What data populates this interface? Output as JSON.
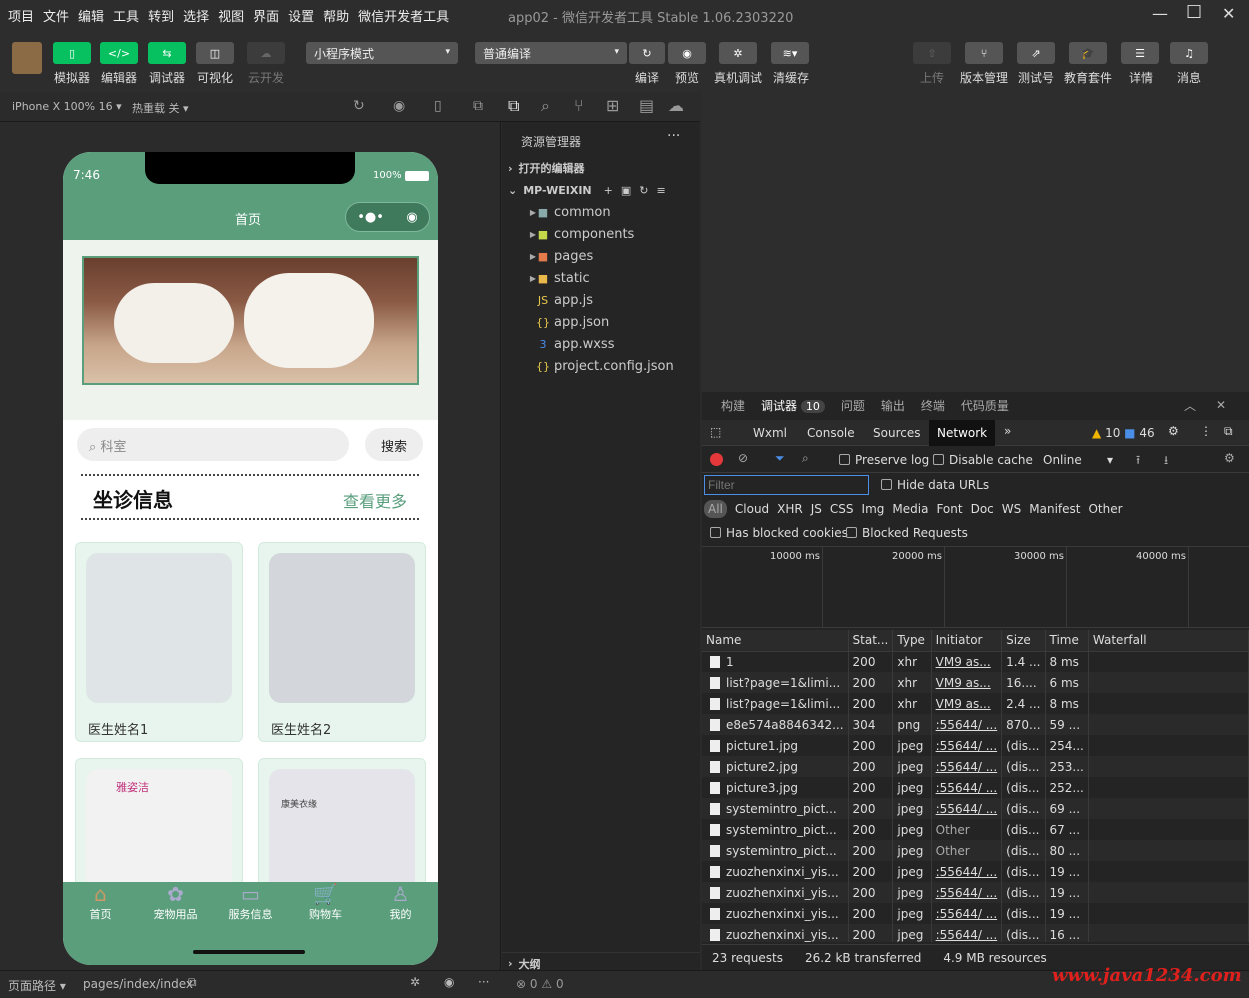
{
  "menu": [
    "项目",
    "文件",
    "编辑",
    "工具",
    "转到",
    "选择",
    "视图",
    "界面",
    "设置",
    "帮助",
    "微信开发者工具"
  ],
  "title": "app02 - 微信开发者工具 Stable 1.06.2303220",
  "toolbar": {
    "simulator": "模拟器",
    "editor": "编辑器",
    "debugger": "调试器",
    "visual": "可视化",
    "cloud": "云开发",
    "mode": "小程序模式",
    "compile_mode": "普通编译",
    "compile": "编译",
    "preview": "预览",
    "remote_debug": "真机调试",
    "clear_cache": "清缓存",
    "upload": "上传",
    "version": "版本管理",
    "test": "测试号",
    "edu": "教育套件",
    "details": "详情",
    "messages": "消息",
    "accent": "#07c160"
  },
  "simbar": {
    "device": "iPhone X 100% 16 ▾",
    "hotreload": "热重载 关 ▾"
  },
  "phone": {
    "time": "7:46",
    "battery": "100%",
    "page_title": "首页",
    "search_placeholder": "科室",
    "search_btn": "搜索",
    "section_title": "坐诊信息",
    "more": "查看更多",
    "doctors": [
      "医生姓名1",
      "医生姓名2"
    ],
    "brand1": "雅姿洁",
    "brand2": "康美衣缘",
    "tabs": [
      "首页",
      "宠物用品",
      "服务信息",
      "购物车",
      "我的"
    ],
    "theme": "#5a9e7c"
  },
  "explorer": {
    "title": "资源管理器",
    "open_editors": "打开的编辑器",
    "project": "MP-WEIXIN",
    "items": [
      {
        "name": "common",
        "type": "folder"
      },
      {
        "name": "components",
        "type": "folder"
      },
      {
        "name": "pages",
        "type": "folder"
      },
      {
        "name": "static",
        "type": "folder"
      },
      {
        "name": "app.js",
        "type": "js"
      },
      {
        "name": "app.json",
        "type": "json"
      },
      {
        "name": "app.wxss",
        "type": "css"
      },
      {
        "name": "project.config.json",
        "type": "json"
      }
    ],
    "outline": "大纲",
    "problems": "0",
    "warnings": "0"
  },
  "devtools": {
    "tabs": [
      "构建",
      "调试器",
      "问题",
      "输出",
      "终端",
      "代码质量"
    ],
    "debugger_badge": "10",
    "panels": [
      "Wxml",
      "Console",
      "Sources",
      "Network"
    ],
    "warn_count": "10",
    "msg_count": "46",
    "preserve_log": "Preserve log",
    "disable_cache": "Disable cache",
    "throttle": "Online",
    "filter_placeholder": "Filter",
    "hide_data_urls": "Hide data URLs",
    "types": [
      "All",
      "Cloud",
      "XHR",
      "JS",
      "CSS",
      "Img",
      "Media",
      "Font",
      "Doc",
      "WS",
      "Manifest",
      "Other"
    ],
    "has_blocked": "Has blocked cookies",
    "blocked_requests": "Blocked Requests",
    "timeline": [
      "10000 ms",
      "20000 ms",
      "30000 ms",
      "40000 ms"
    ],
    "columns": [
      "Name",
      "Stat...",
      "Type",
      "Initiator",
      "Size",
      "Time",
      "Waterfall"
    ],
    "rows": [
      [
        "1",
        "200",
        "xhr",
        "VM9 as...",
        "1.4 ...",
        "8 ms"
      ],
      [
        "list?page=1&limi...",
        "200",
        "xhr",
        "VM9 as...",
        "16....",
        "6 ms"
      ],
      [
        "list?page=1&limi...",
        "200",
        "xhr",
        "VM9 as...",
        "2.4 ...",
        "8 ms"
      ],
      [
        "e8e574a8846342...",
        "304",
        "png",
        ":55644/ ...",
        "870...",
        "59 ..."
      ],
      [
        "picture1.jpg",
        "200",
        "jpeg",
        ":55644/ ...",
        "(dis...",
        "254..."
      ],
      [
        "picture2.jpg",
        "200",
        "jpeg",
        ":55644/ ...",
        "(dis...",
        "253..."
      ],
      [
        "picture3.jpg",
        "200",
        "jpeg",
        ":55644/ ...",
        "(dis...",
        "252..."
      ],
      [
        "systemintro_pict...",
        "200",
        "jpeg",
        ":55644/ ...",
        "(dis...",
        "69 ..."
      ],
      [
        "systemintro_pict...",
        "200",
        "jpeg",
        "Other",
        "(dis...",
        "67 ..."
      ],
      [
        "systemintro_pict...",
        "200",
        "jpeg",
        "Other",
        "(dis...",
        "80 ..."
      ],
      [
        "zuozhenxinxi_yis...",
        "200",
        "jpeg",
        ":55644/ ...",
        "(dis...",
        "19 ..."
      ],
      [
        "zuozhenxinxi_yis...",
        "200",
        "jpeg",
        ":55644/ ...",
        "(dis...",
        "19 ..."
      ],
      [
        "zuozhenxinxi_yis...",
        "200",
        "jpeg",
        ":55644/ ...",
        "(dis...",
        "19 ..."
      ],
      [
        "zuozhenxinxi_yis...",
        "200",
        "jpeg",
        ":55644/ ...",
        "(dis...",
        "16 ..."
      ]
    ],
    "summary": {
      "requests": "23 requests",
      "transferred": "26.2 kB transferred",
      "resources": "4.9 MB resources"
    }
  },
  "statusbar": {
    "path_label": "页面路径 ▾",
    "path": "pages/index/index"
  },
  "watermark": "www.java1234.com"
}
